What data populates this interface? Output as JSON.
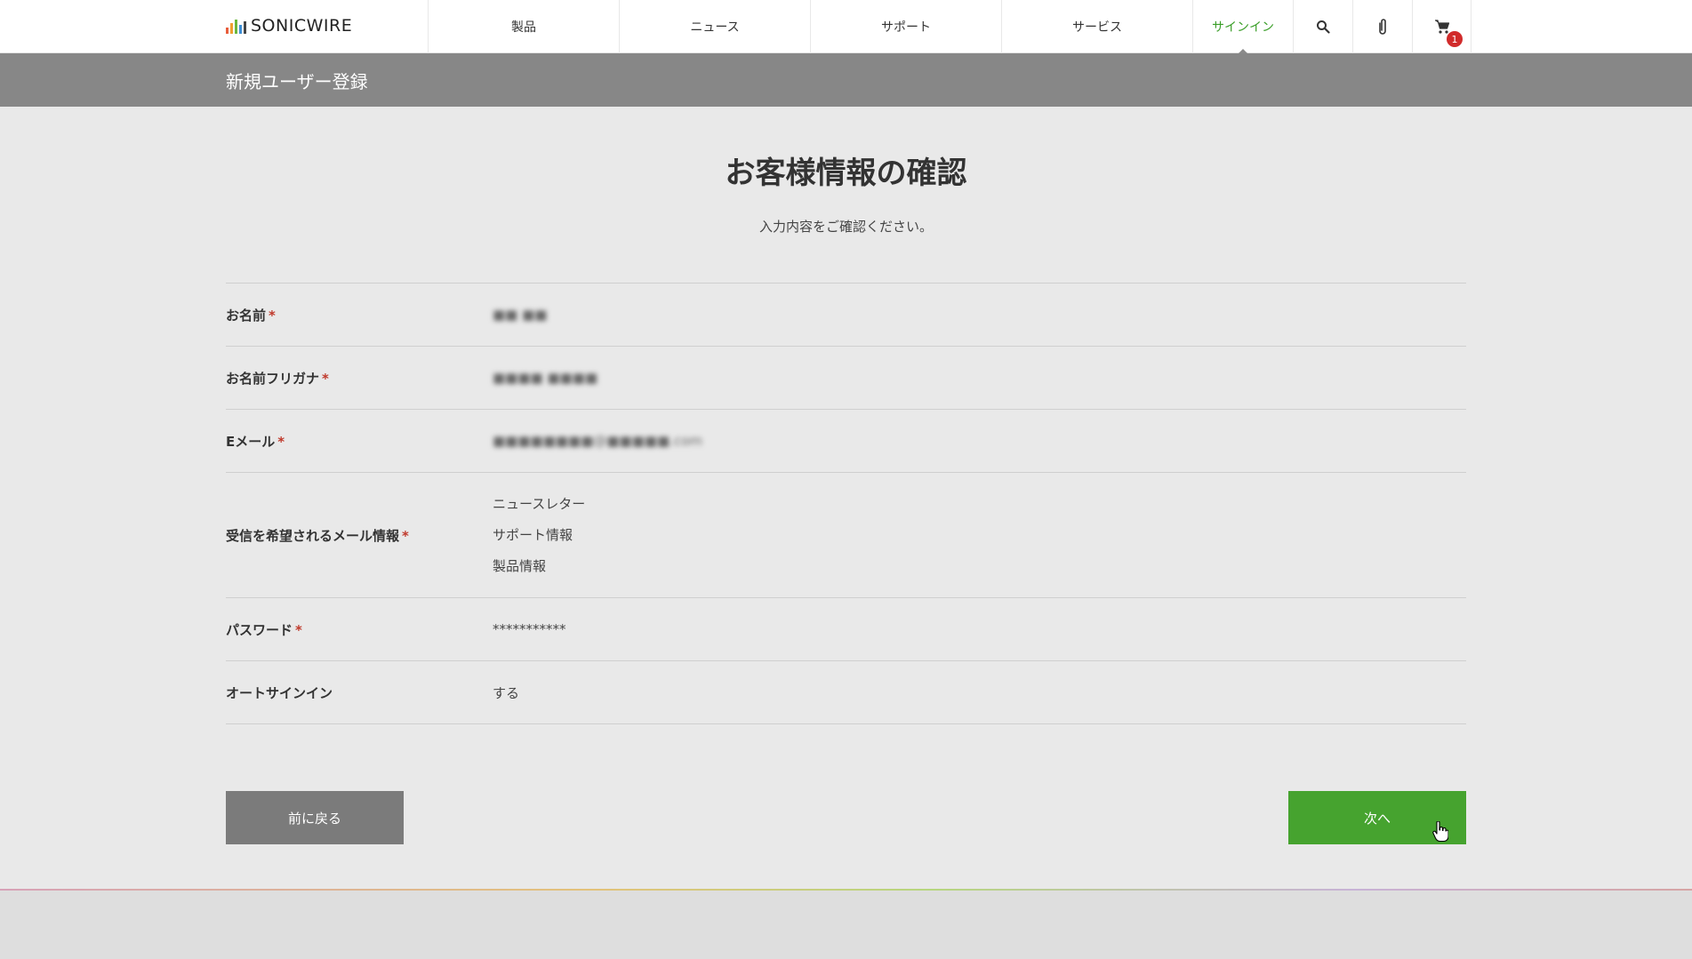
{
  "header": {
    "logo_text": "SONICWIRE",
    "nav": [
      {
        "label": "製品"
      },
      {
        "label": "ニュース"
      },
      {
        "label": "サポート"
      },
      {
        "label": "サービス"
      },
      {
        "label": "サインイン"
      }
    ],
    "cart_count": "1",
    "icons": [
      "search-icon",
      "paperclip-icon",
      "cart-icon"
    ],
    "accent_color": "#3a9e28"
  },
  "title_band": {
    "title": "新規ユーザー登録"
  },
  "main": {
    "heading": "お客様情報の確認",
    "subheading": "入力内容をご確認ください。",
    "required_mark": "*",
    "rows": [
      {
        "label": "お名前",
        "value": "■■ ■■"
      },
      {
        "label": "お名前フリガナ",
        "value": "■■■■ ■■■■"
      },
      {
        "label": "Eメール",
        "value": "■■■■■■■■@■■■■■.com"
      },
      {
        "label": "受信を希望されるメール情報",
        "values": [
          "ニュースレター",
          "サポート情報",
          "製品情報"
        ]
      },
      {
        "label": "パスワード",
        "value": "***********"
      },
      {
        "label": "オートサインイン",
        "value": "する"
      }
    ]
  },
  "buttons": {
    "back_label": "前に戻る",
    "next_label": "次へ",
    "next_color": "#46a32f",
    "back_color": "#7b7b7b"
  }
}
